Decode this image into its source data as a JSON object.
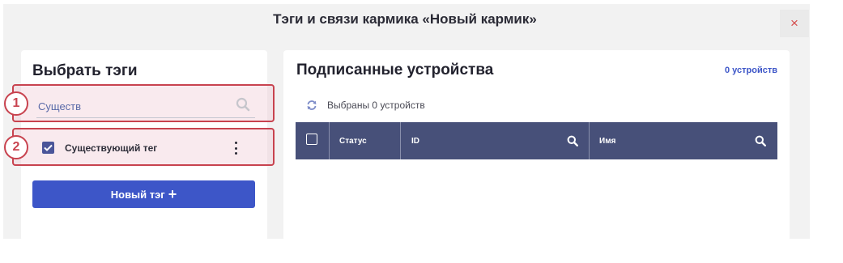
{
  "header": {
    "title": "Тэги и связи кармика «Новый кармик»",
    "close_symbol": "×"
  },
  "left_panel": {
    "title": "Выбрать тэги",
    "search": {
      "value": "Существ",
      "placeholder": ""
    },
    "tags": [
      {
        "label": "Существующий тег",
        "checked": true
      }
    ],
    "new_tag_button": {
      "label": "Новый тэг",
      "icon": "plus-icon"
    }
  },
  "annotations": {
    "badge1": "1",
    "badge2": "2"
  },
  "right_panel": {
    "title": "Подписанные устройства",
    "device_count": "0 устройств",
    "selected_text": "Выбраны 0 устройств",
    "table": {
      "columns": [
        "Статус",
        "ID",
        "Имя"
      ]
    }
  },
  "colors": {
    "accent": "#3d56c8",
    "table_header": "#475079",
    "highlight": "#c8434f",
    "close": "#d44b4b"
  }
}
